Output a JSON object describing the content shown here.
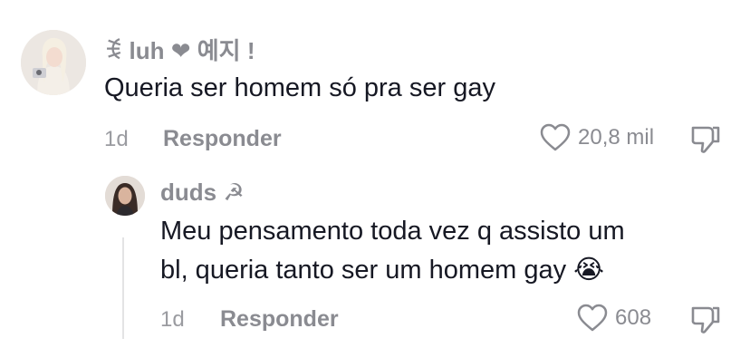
{
  "comments": [
    {
      "username": "ꉂ luh ❤ 예지 !",
      "text": "Queria ser homem só pra ser gay",
      "time": "1d",
      "reply_label": "Responder",
      "likes": "20,8 mil",
      "avatar_icon": "avatar-blonde-with-camera"
    }
  ],
  "reply": {
    "username": "duds ☭",
    "text_line1": "Meu pensamento toda vez q assisto um",
    "text_line2": "bl, queria tanto ser um homem gay 😭",
    "time": "1d",
    "reply_label": "Responder",
    "likes": "608",
    "avatar_icon": "avatar-dark-hair"
  },
  "icons": {
    "like": "heart-outline-icon",
    "dislike": "thumbs-down-icon"
  },
  "colors": {
    "text": "#161823",
    "muted": "#8a8b91",
    "background": "#ffffff"
  }
}
